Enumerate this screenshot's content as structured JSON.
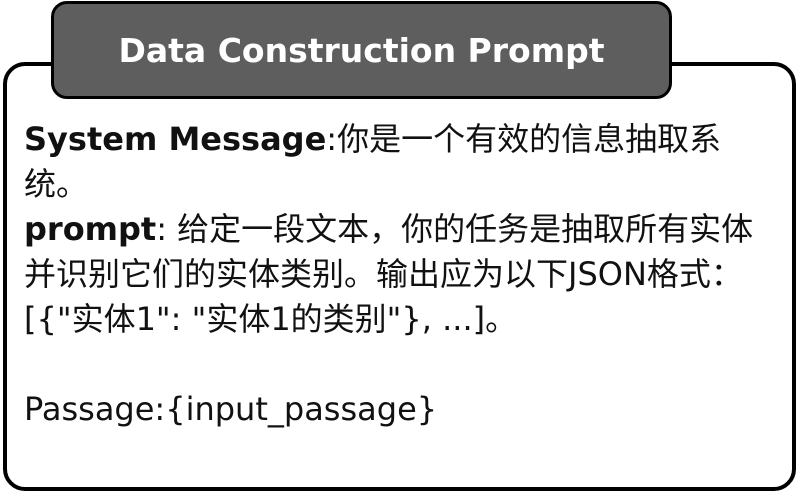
{
  "header": {
    "title": "Data Construction Prompt"
  },
  "system": {
    "label": "System Message",
    "text": ":你是一个有效的信息抽取系统。"
  },
  "prompt": {
    "label": "prompt",
    "text": ": 给定一段文本，你的任务是抽取所有实体并识别它们的实体类别。输出应为以下JSON格式：[{\"实体1\": \"实体1的类别\"}, ...]。"
  },
  "passage": {
    "text": "Passage:{input_passage}"
  },
  "colors": {
    "tab_background": "#5e5e5e",
    "tab_text": "#ffffff",
    "border": "#000000"
  }
}
